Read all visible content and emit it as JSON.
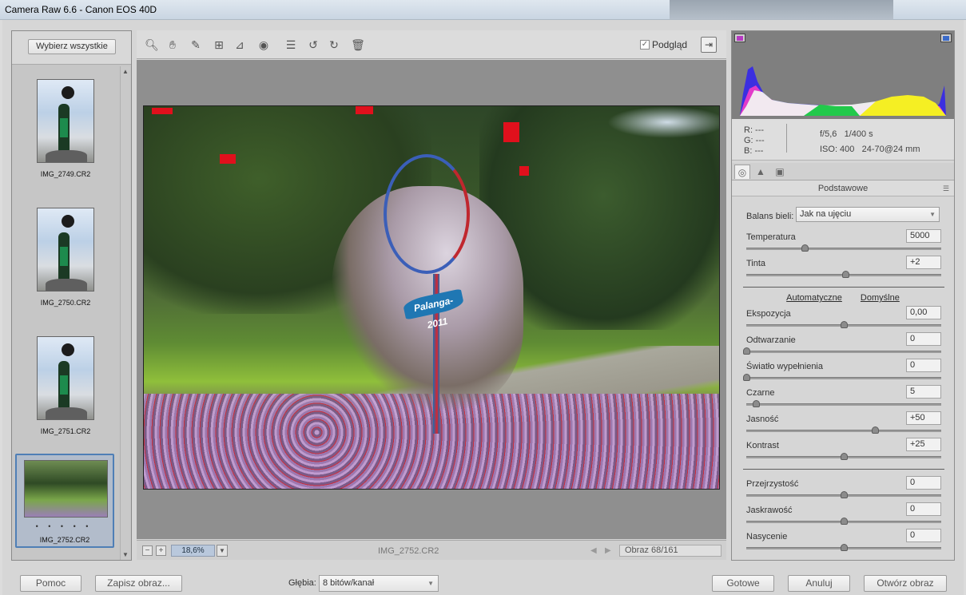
{
  "window": {
    "title": "Camera Raw 6.6  -  Canon EOS 40D"
  },
  "filmstrip": {
    "select_all": "Wybierz wszystkie",
    "items": [
      {
        "name": "IMG_2749.CR2",
        "selected": false
      },
      {
        "name": "IMG_2750.CR2",
        "selected": false
      },
      {
        "name": "IMG_2751.CR2",
        "selected": false
      },
      {
        "name": "IMG_2752.CR2",
        "selected": true,
        "rating_dots": "• • • • •"
      }
    ]
  },
  "toolbar": {
    "tools": [
      "zoom-icon",
      "hand-icon",
      "eyedropper-icon",
      "crop-icon",
      "straighten-icon",
      "redeye-icon",
      "list-icon",
      "rotate-left-icon",
      "rotate-right-icon",
      "trash-icon"
    ],
    "preview_label": "Podgląd",
    "preview_checked": true
  },
  "photo": {
    "sign_text": "Palanga-2011"
  },
  "canvas_status": {
    "zoom": "18,6%",
    "filename": "IMG_2752.CR2",
    "count": "Obraz 68/161"
  },
  "readout": {
    "r": "R:  ---",
    "g": "G:  ---",
    "b": "B:  ---",
    "aperture": "f/5,6",
    "shutter": "1/400 s",
    "iso": "ISO: 400",
    "lens": "24-70@24 mm"
  },
  "panel": {
    "title": "Podstawowe",
    "wb_label": "Balans bieli:",
    "wb_value": "Jak na ujęciu",
    "auto_link": "Automatyczne",
    "default_link": "Domyślne",
    "sliders": [
      {
        "label": "Temperatura",
        "value": "5000",
        "position": 0.3
      },
      {
        "label": "Tinta",
        "value": "+2",
        "position": 0.51
      },
      {
        "label": "Ekspozycja",
        "value": "0,00",
        "position": 0.5
      },
      {
        "label": "Odtwarzanie",
        "value": "0",
        "position": 0.0
      },
      {
        "label": "Światło wypełnienia",
        "value": "0",
        "position": 0.0
      },
      {
        "label": "Czarne",
        "value": "5",
        "position": 0.05
      },
      {
        "label": "Jasność",
        "value": "+50",
        "position": 0.66
      },
      {
        "label": "Kontrast",
        "value": "+25",
        "position": 0.5
      },
      {
        "label": "Przejrzystość",
        "value": "0",
        "position": 0.5
      },
      {
        "label": "Jaskrawość",
        "value": "0",
        "position": 0.5
      },
      {
        "label": "Nasycenie",
        "value": "0",
        "position": 0.5
      }
    ]
  },
  "bottom": {
    "help": "Pomoc",
    "save": "Zapisz obraz...",
    "depth_label": "Głębia:",
    "depth_value": "8 bitów/kanał",
    "done": "Gotowe",
    "cancel": "Anuluj",
    "open": "Otwórz obraz"
  }
}
